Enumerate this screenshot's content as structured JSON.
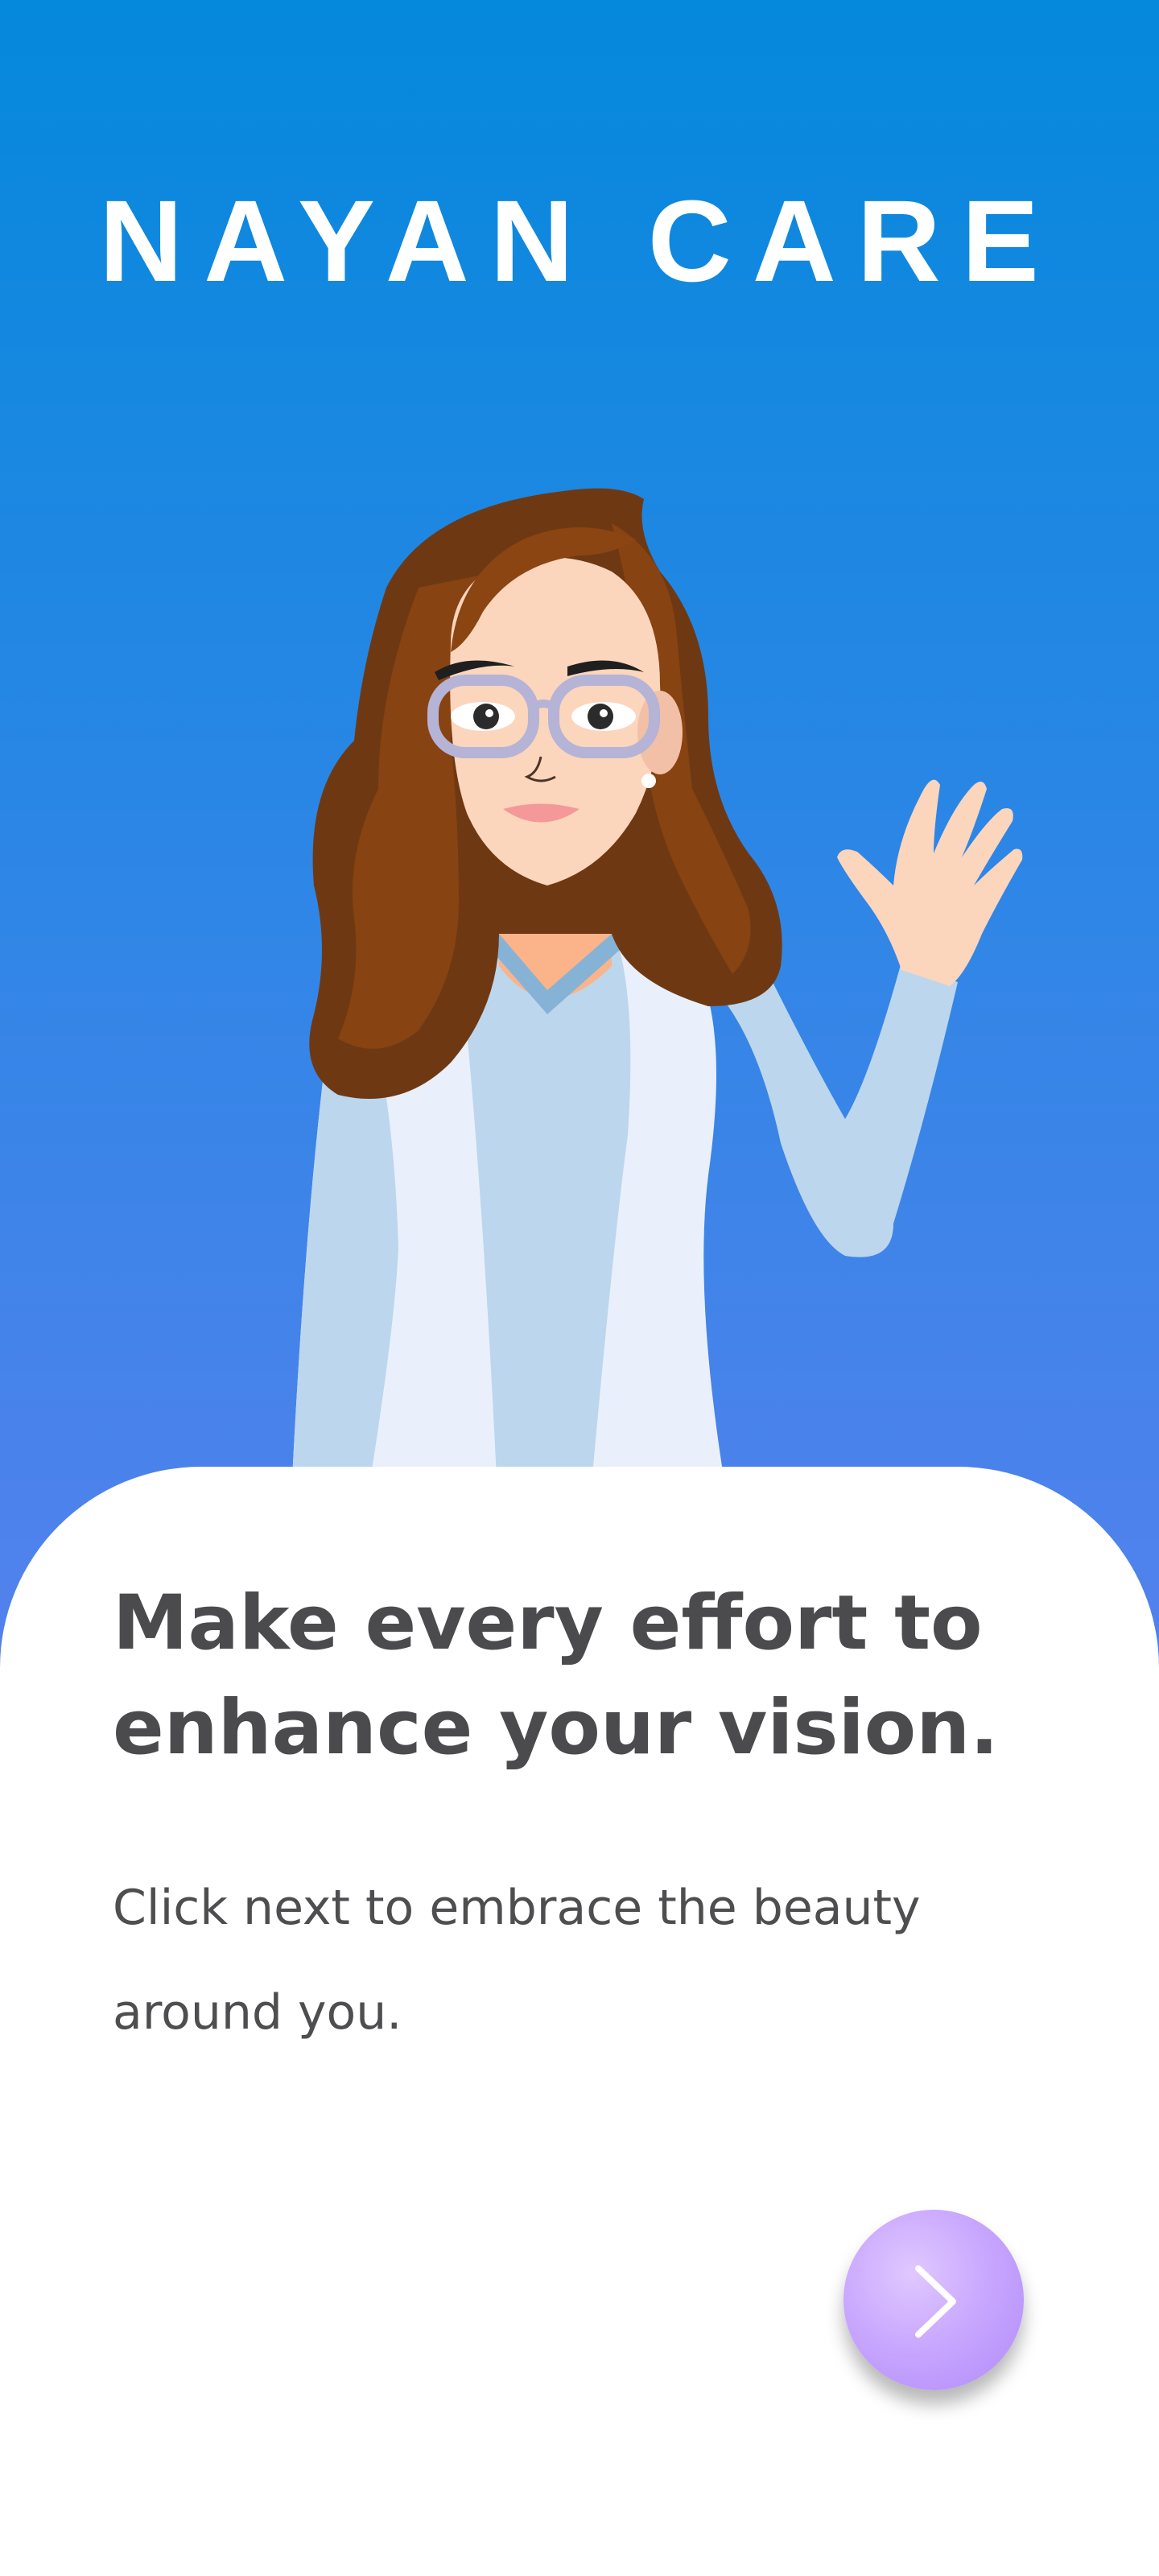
{
  "app": {
    "title": "NAYAN CARE"
  },
  "onboarding": {
    "headline": "Make every effort to enhance your vision.",
    "subtext": "Click next to embrace the beauty around you.",
    "next_icon": "chevron-right-icon"
  },
  "colors": {
    "background_top": "#0489dc",
    "background_bottom": "#6d86f2",
    "card": "#ffffff",
    "headline_text": "#4b4b4d",
    "next_button": "#c9a8ff"
  }
}
